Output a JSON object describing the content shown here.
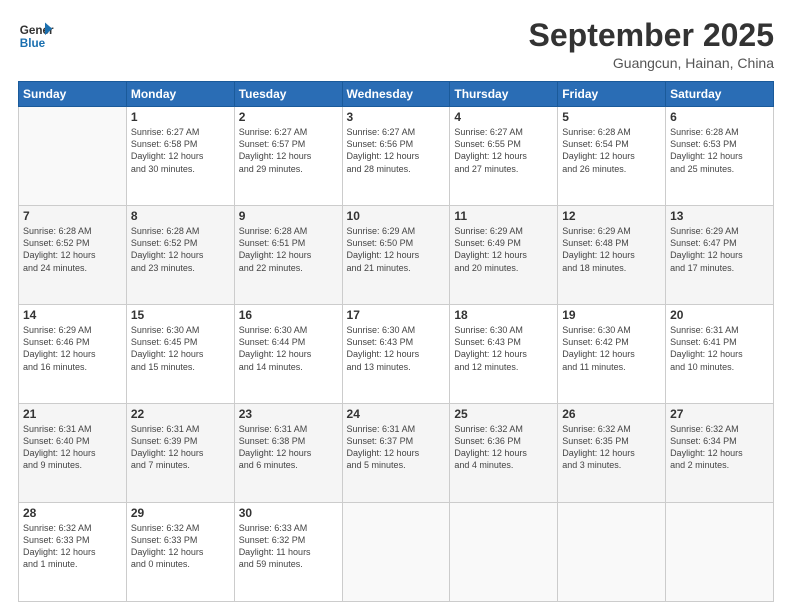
{
  "header": {
    "logo_line1": "General",
    "logo_line2": "Blue",
    "month": "September 2025",
    "location": "Guangcun, Hainan, China"
  },
  "weekdays": [
    "Sunday",
    "Monday",
    "Tuesday",
    "Wednesday",
    "Thursday",
    "Friday",
    "Saturday"
  ],
  "weeks": [
    [
      {
        "day": "",
        "info": ""
      },
      {
        "day": "1",
        "info": "Sunrise: 6:27 AM\nSunset: 6:58 PM\nDaylight: 12 hours\nand 30 minutes."
      },
      {
        "day": "2",
        "info": "Sunrise: 6:27 AM\nSunset: 6:57 PM\nDaylight: 12 hours\nand 29 minutes."
      },
      {
        "day": "3",
        "info": "Sunrise: 6:27 AM\nSunset: 6:56 PM\nDaylight: 12 hours\nand 28 minutes."
      },
      {
        "day": "4",
        "info": "Sunrise: 6:27 AM\nSunset: 6:55 PM\nDaylight: 12 hours\nand 27 minutes."
      },
      {
        "day": "5",
        "info": "Sunrise: 6:28 AM\nSunset: 6:54 PM\nDaylight: 12 hours\nand 26 minutes."
      },
      {
        "day": "6",
        "info": "Sunrise: 6:28 AM\nSunset: 6:53 PM\nDaylight: 12 hours\nand 25 minutes."
      }
    ],
    [
      {
        "day": "7",
        "info": "Sunrise: 6:28 AM\nSunset: 6:52 PM\nDaylight: 12 hours\nand 24 minutes."
      },
      {
        "day": "8",
        "info": "Sunrise: 6:28 AM\nSunset: 6:52 PM\nDaylight: 12 hours\nand 23 minutes."
      },
      {
        "day": "9",
        "info": "Sunrise: 6:28 AM\nSunset: 6:51 PM\nDaylight: 12 hours\nand 22 minutes."
      },
      {
        "day": "10",
        "info": "Sunrise: 6:29 AM\nSunset: 6:50 PM\nDaylight: 12 hours\nand 21 minutes."
      },
      {
        "day": "11",
        "info": "Sunrise: 6:29 AM\nSunset: 6:49 PM\nDaylight: 12 hours\nand 20 minutes."
      },
      {
        "day": "12",
        "info": "Sunrise: 6:29 AM\nSunset: 6:48 PM\nDaylight: 12 hours\nand 18 minutes."
      },
      {
        "day": "13",
        "info": "Sunrise: 6:29 AM\nSunset: 6:47 PM\nDaylight: 12 hours\nand 17 minutes."
      }
    ],
    [
      {
        "day": "14",
        "info": "Sunrise: 6:29 AM\nSunset: 6:46 PM\nDaylight: 12 hours\nand 16 minutes."
      },
      {
        "day": "15",
        "info": "Sunrise: 6:30 AM\nSunset: 6:45 PM\nDaylight: 12 hours\nand 15 minutes."
      },
      {
        "day": "16",
        "info": "Sunrise: 6:30 AM\nSunset: 6:44 PM\nDaylight: 12 hours\nand 14 minutes."
      },
      {
        "day": "17",
        "info": "Sunrise: 6:30 AM\nSunset: 6:43 PM\nDaylight: 12 hours\nand 13 minutes."
      },
      {
        "day": "18",
        "info": "Sunrise: 6:30 AM\nSunset: 6:43 PM\nDaylight: 12 hours\nand 12 minutes."
      },
      {
        "day": "19",
        "info": "Sunrise: 6:30 AM\nSunset: 6:42 PM\nDaylight: 12 hours\nand 11 minutes."
      },
      {
        "day": "20",
        "info": "Sunrise: 6:31 AM\nSunset: 6:41 PM\nDaylight: 12 hours\nand 10 minutes."
      }
    ],
    [
      {
        "day": "21",
        "info": "Sunrise: 6:31 AM\nSunset: 6:40 PM\nDaylight: 12 hours\nand 9 minutes."
      },
      {
        "day": "22",
        "info": "Sunrise: 6:31 AM\nSunset: 6:39 PM\nDaylight: 12 hours\nand 7 minutes."
      },
      {
        "day": "23",
        "info": "Sunrise: 6:31 AM\nSunset: 6:38 PM\nDaylight: 12 hours\nand 6 minutes."
      },
      {
        "day": "24",
        "info": "Sunrise: 6:31 AM\nSunset: 6:37 PM\nDaylight: 12 hours\nand 5 minutes."
      },
      {
        "day": "25",
        "info": "Sunrise: 6:32 AM\nSunset: 6:36 PM\nDaylight: 12 hours\nand 4 minutes."
      },
      {
        "day": "26",
        "info": "Sunrise: 6:32 AM\nSunset: 6:35 PM\nDaylight: 12 hours\nand 3 minutes."
      },
      {
        "day": "27",
        "info": "Sunrise: 6:32 AM\nSunset: 6:34 PM\nDaylight: 12 hours\nand 2 minutes."
      }
    ],
    [
      {
        "day": "28",
        "info": "Sunrise: 6:32 AM\nSunset: 6:33 PM\nDaylight: 12 hours\nand 1 minute."
      },
      {
        "day": "29",
        "info": "Sunrise: 6:32 AM\nSunset: 6:33 PM\nDaylight: 12 hours\nand 0 minutes."
      },
      {
        "day": "30",
        "info": "Sunrise: 6:33 AM\nSunset: 6:32 PM\nDaylight: 11 hours\nand 59 minutes."
      },
      {
        "day": "",
        "info": ""
      },
      {
        "day": "",
        "info": ""
      },
      {
        "day": "",
        "info": ""
      },
      {
        "day": "",
        "info": ""
      }
    ]
  ]
}
